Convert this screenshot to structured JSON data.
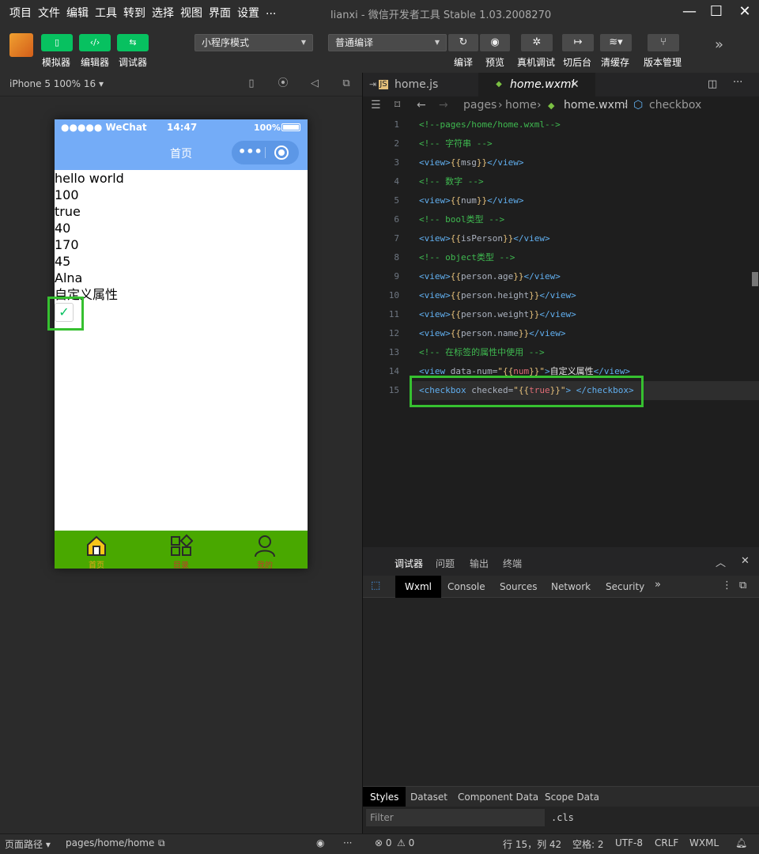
{
  "menu": {
    "items": [
      "项目",
      "文件",
      "编辑",
      "工具",
      "转到",
      "选择",
      "视图",
      "界面",
      "设置",
      "..."
    ],
    "app_title": "lianxi - 微信开发者工具 Stable 1.03.2008270"
  },
  "toolbar": {
    "simulator": "模拟器",
    "editor": "编辑器",
    "debugger": "调试器",
    "mode_select": "小程序模式",
    "compile_select": "普通编译",
    "compile": "编译",
    "preview": "预览",
    "real_debug": "真机调试",
    "background": "切后台",
    "clear_cache": "清缓存",
    "version": "版本管理"
  },
  "simulator": {
    "device": "iPhone 5 100% 16 ▾",
    "status_left": "●●●●● WeChat",
    "status_time": "14:47",
    "status_battery": "100%",
    "nav_title": "首页",
    "lines": [
      "hello world",
      "100",
      "true",
      "40",
      "170",
      "45",
      "Alna",
      "自定义属性"
    ],
    "tabs": [
      {
        "label": "首页",
        "icon": "home-icon"
      },
      {
        "label": "目录",
        "icon": "grid-icon"
      },
      {
        "label": "我的",
        "icon": "user-icon"
      }
    ]
  },
  "editor": {
    "tab1": "home.js",
    "tab2": "home.wxml",
    "breadcrumb": [
      "pages",
      "home",
      "home.wxml",
      "checkbox"
    ],
    "line_numbers": [
      "1",
      "2",
      "3",
      "4",
      "5",
      "6",
      "7",
      "8",
      "9",
      "10",
      "11",
      "12",
      "13",
      "14",
      "15"
    ]
  },
  "debug": {
    "top_tabs": [
      "调试器",
      "问题",
      "输出",
      "终端"
    ],
    "devtools_tabs": [
      "Wxml",
      "Console",
      "Sources",
      "Network",
      "Security"
    ],
    "style_tabs": [
      "Styles",
      "Dataset",
      "Component Data",
      "Scope Data"
    ],
    "filter_placeholder": "Filter",
    "cls": ".cls"
  },
  "statusbar": {
    "page_path_label": "页面路径 ▾",
    "page_path": "pages/home/home",
    "errors": "⊗ 0",
    "warnings": "⚠ 0",
    "position": "行 15，列 42",
    "indent": "空格: 2",
    "encoding": "UTF-8",
    "eol": "CRLF",
    "language": "WXML"
  }
}
